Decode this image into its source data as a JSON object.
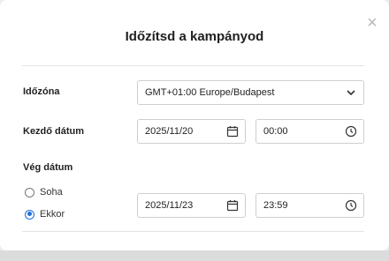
{
  "dialog": {
    "title": "Időzítsd a kampányod",
    "close_symbol": "×"
  },
  "timezone": {
    "label": "Időzóna",
    "selected": "GMT+01:00 Europe/Budapest"
  },
  "start": {
    "label": "Kezdő dátum",
    "date": "2025/11/20",
    "time": "00:00"
  },
  "end": {
    "label": "Vég dátum",
    "options": [
      {
        "label": "Soha",
        "selected": false
      },
      {
        "label": "Ekkor",
        "selected": true
      }
    ],
    "date": "2025/11/23",
    "time": "23:59"
  },
  "colors": {
    "accent": "#1e6fe0",
    "border": "#cfcfcf"
  },
  "icons": {
    "close": "close-icon",
    "dropdown": "chevron-down-icon",
    "date": "calendar-icon",
    "time": "clock-icon"
  }
}
